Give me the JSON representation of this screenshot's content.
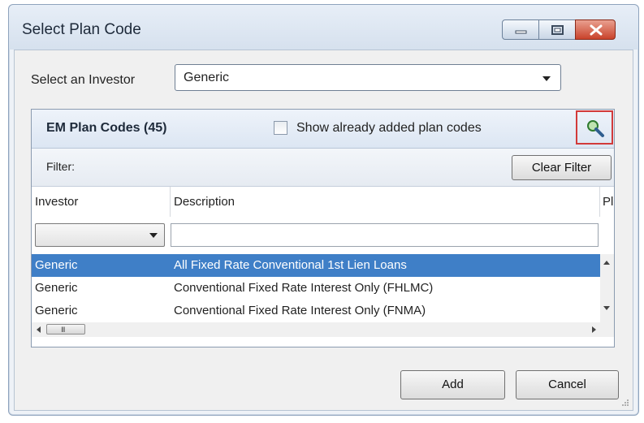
{
  "window": {
    "title": "Select Plan Code"
  },
  "investor": {
    "label": "Select an Investor",
    "selected": "Generic"
  },
  "panel": {
    "title": "EM Plan Codes (45)",
    "show_added_label": "Show already added plan codes",
    "show_added_checked": false
  },
  "filter": {
    "label": "Filter:",
    "clear_label": "Clear Filter"
  },
  "grid": {
    "columns": [
      "Investor",
      "Description",
      "Pla"
    ],
    "rows": [
      {
        "investor": "Generic",
        "description": "All Fixed Rate Conventional 1st Lien Loans",
        "selected": true
      },
      {
        "investor": "Generic",
        "description": "Conventional Fixed Rate Interest Only (FHLMC)",
        "selected": false
      },
      {
        "investor": "Generic",
        "description": "Conventional Fixed Rate Interest Only (FNMA)",
        "selected": false
      }
    ],
    "scroll_thumb": "III"
  },
  "buttons": {
    "add": "Add",
    "cancel": "Cancel"
  },
  "icons": {
    "minimize": "minimize-icon",
    "maximize": "maximize-icon",
    "close": "close-icon",
    "search": "search-icon"
  },
  "colors": {
    "selection": "#3f7fc7",
    "highlight_border": "#d23a3a",
    "close_button": "#c9432b"
  }
}
